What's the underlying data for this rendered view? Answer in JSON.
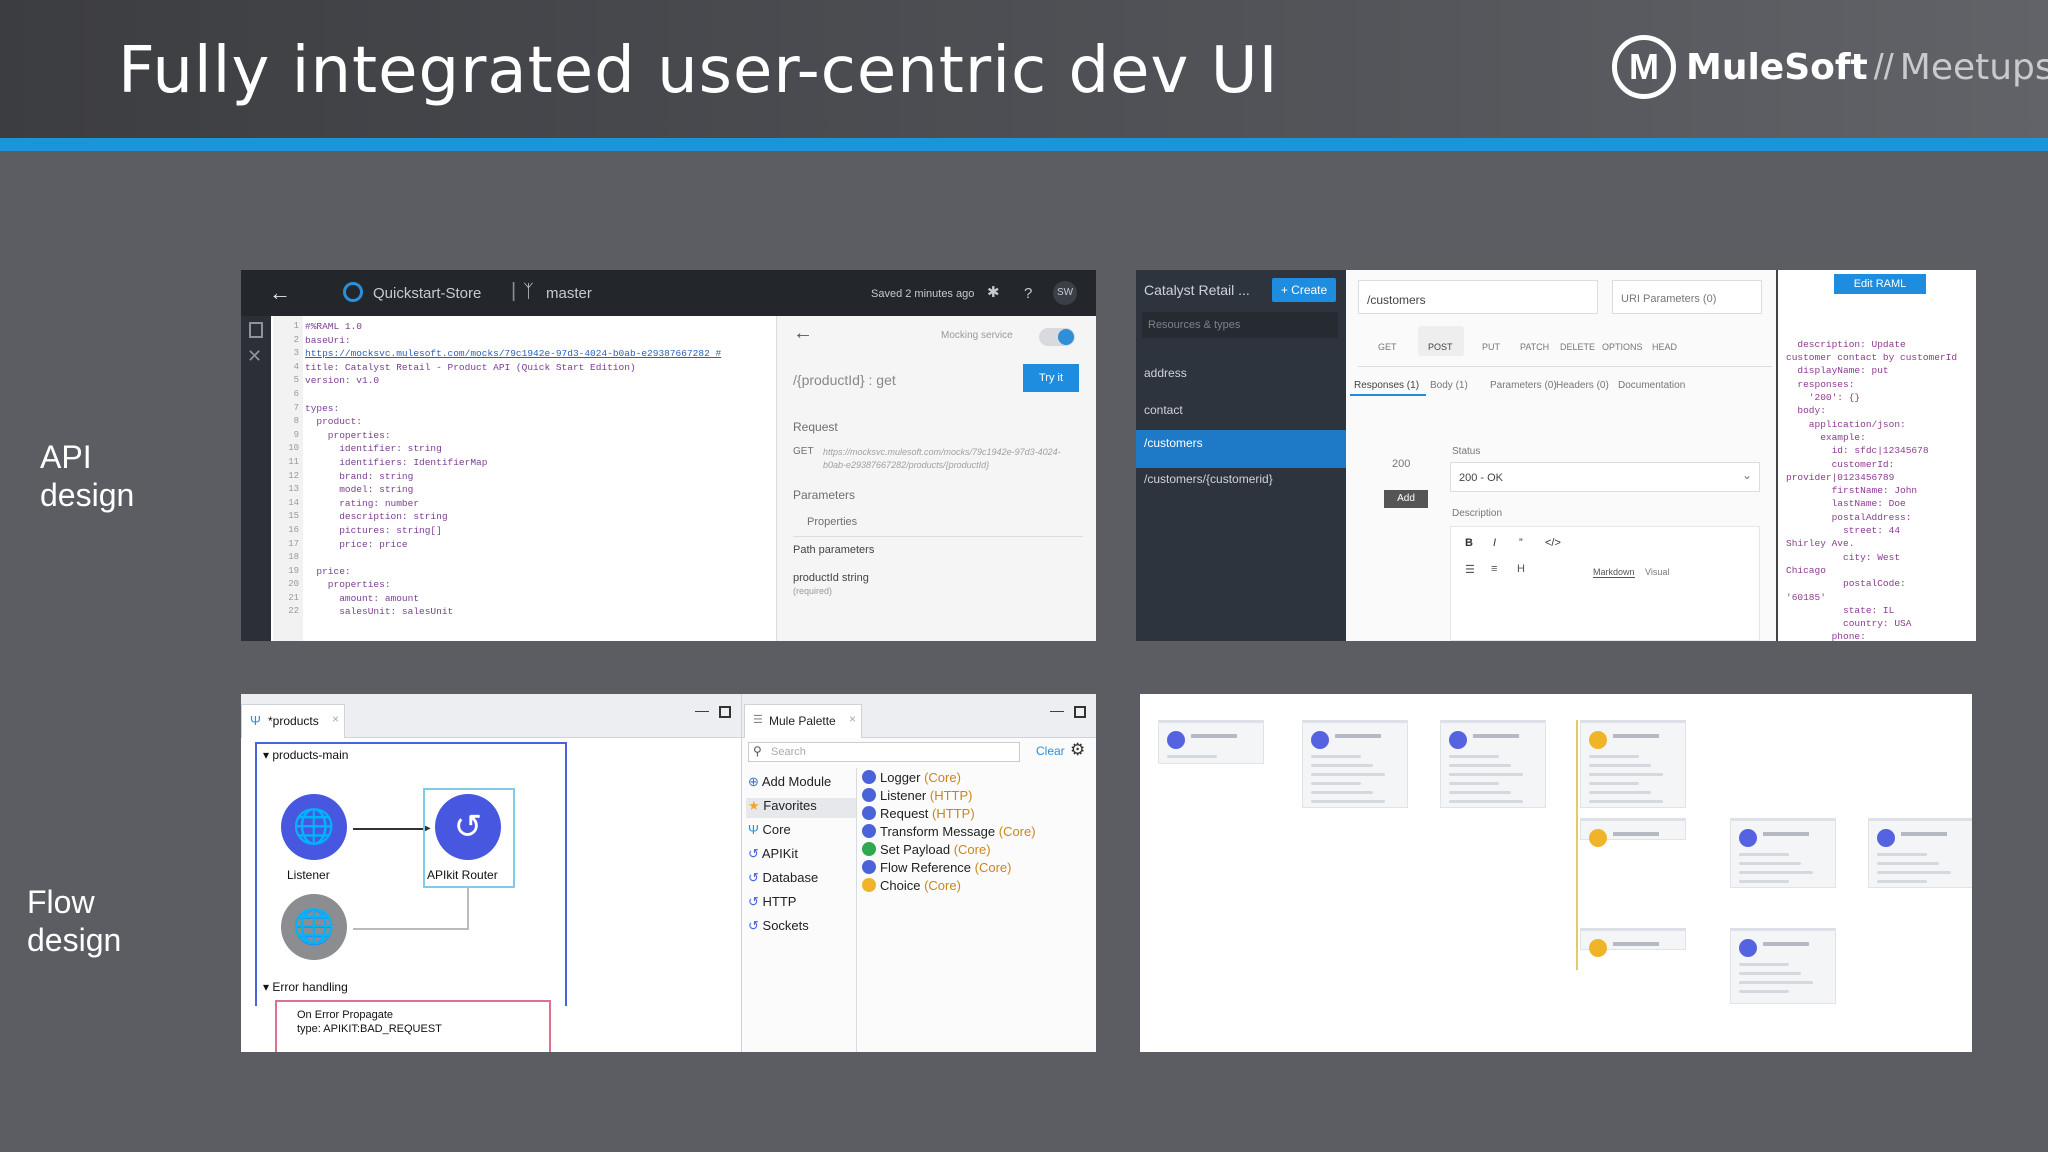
{
  "slide": {
    "title": "Fully integrated user-centric dev UI",
    "logo": {
      "mark": "M",
      "brand": "MuleSoft",
      "separator": "//",
      "sub": "Meetups"
    },
    "labels": {
      "api_design_1": "API",
      "api_design_2": "design",
      "flow_design_1": "Flow",
      "flow_design_2": "design"
    },
    "colors": {
      "accent_bar": "#1b95d8",
      "background": "#5b5d62",
      "header": "#3c3d41"
    }
  },
  "api_designer": {
    "project": "Quickstart-Store",
    "branch": "master",
    "saved": "Saved 2 minutes ago",
    "help": "?",
    "avatar": "SW",
    "line_numbers": [
      "1",
      "2",
      "3",
      "4",
      "5",
      "6",
      "7",
      "8",
      "9",
      "10",
      "11",
      "12",
      "13",
      "14",
      "15",
      "16",
      "17",
      "18",
      "19",
      "20",
      "21",
      "22"
    ],
    "code": [
      "#%RAML 1.0",
      "baseUri:",
      "https://mocksvc.mulesoft.com/mocks/79c1942e-97d3-4024-b0ab-e29387667282 #",
      "title: Catalyst Retail - Product API (Quick Start Edition)",
      "version: v1.0",
      "",
      "types:",
      "  product:",
      "    properties:",
      "      identifier: string",
      "      identifiers: IdentifierMap",
      "      brand: string",
      "      model: string",
      "      rating: number",
      "      description: string",
      "      pictures: string[]",
      "      price: price",
      "",
      "  price:",
      "    properties:",
      "      amount: amount",
      "      salesUnit: salesUnit"
    ],
    "mocking_label": "Mocking service",
    "resource": "/{productId} : get",
    "try_it": "Try it",
    "request_label": "Request",
    "method": "GET",
    "request_url": "https://mocksvc.mulesoft.com/mocks/79c1942e-97d3-4024-b0ab-e29387667282/products/{productId}",
    "parameters_label": "Parameters",
    "properties_label": "Properties",
    "path_params_label": "Path parameters",
    "param_name": "productId string",
    "param_required": "(required)"
  },
  "api_editor": {
    "project": "Catalyst Retail ...",
    "create": "+ Create",
    "search_placeholder": "Resources & types",
    "resources": [
      "address",
      "contact",
      "/customers",
      "/customers/{customerid}"
    ],
    "path_value": "/customers",
    "uri_params": "URI Parameters (0)",
    "methods": [
      "GET",
      "POST",
      "PUT",
      "PATCH",
      "DELETE",
      "OPTIONS",
      "HEAD"
    ],
    "tabs": [
      "Responses (1)",
      "Body (1)",
      "Parameters (0)",
      "Headers (0)",
      "Documentation"
    ],
    "status_label": "Status",
    "status_code": "200",
    "status_value": "200 - OK",
    "add": "Add",
    "description_label": "Description",
    "format_buttons": [
      "B",
      "I",
      "”",
      "</>"
    ],
    "list_buttons": [
      "☰",
      "≡",
      "H"
    ],
    "view_modes": [
      "Markdown",
      "Visual"
    ],
    "edit_raml": "Edit RAML",
    "raml": [
      "  description: Update",
      "customer contact by customerId",
      "  displayName: put",
      "  responses:",
      "    '200': {}",
      "  body:",
      "    application/json:",
      "      example:",
      "        id: sfdc|12345678",
      "        customerId:",
      "provider|0123456789",
      "        firstName: John",
      "        lastName: Doe",
      "        postalAddress:",
      "          street: 44",
      "Shirley Ave.",
      "          city: West",
      "Chicago",
      "          postalCode:",
      "'60185'",
      "          state: IL",
      "          country: USA",
      "        phone:"
    ]
  },
  "flow_editor": {
    "tab": "*products",
    "flow_name": "products-main",
    "listener_label": "Listener",
    "router_label": "APIkit Router",
    "error_handling": "Error handling",
    "on_error": "On Error Propagate",
    "error_type": "type: APIKIT:BAD_REQUEST",
    "palette_title": "Mule Palette",
    "search_placeholder": "Search",
    "clear": "Clear",
    "modules": [
      "Add Module",
      "Favorites",
      "Core",
      "APIKit",
      "Database",
      "HTTP",
      "Sockets"
    ],
    "components": [
      {
        "name": "Logger",
        "module": "(Core)"
      },
      {
        "name": "Listener",
        "module": "(HTTP)"
      },
      {
        "name": "Request",
        "module": "(HTTP)"
      },
      {
        "name": "Transform Message",
        "module": "(Core)"
      },
      {
        "name": "Set Payload",
        "module": "(Core)"
      },
      {
        "name": "Flow Reference",
        "module": "(Core)"
      },
      {
        "name": "Choice",
        "module": "(Core)"
      }
    ]
  }
}
